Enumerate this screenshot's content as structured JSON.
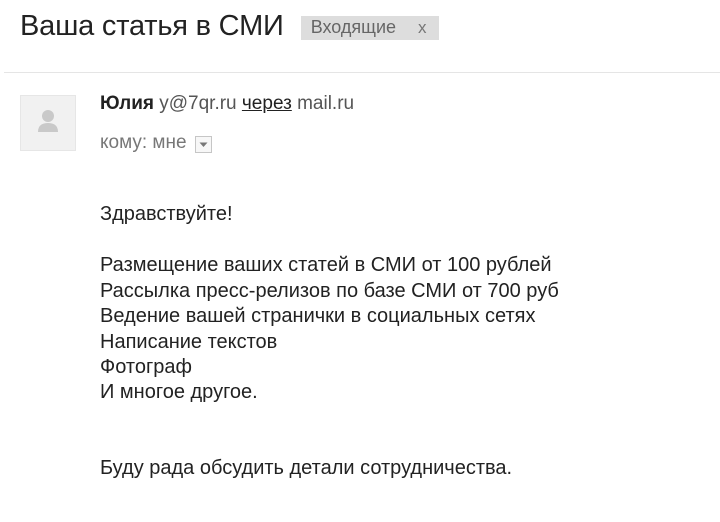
{
  "email": {
    "subject": "Ваша статья в СМИ",
    "label": {
      "name": "Входящие",
      "remove_glyph": "x"
    },
    "sender": {
      "name": "Юлия",
      "email": "y@7qr.ru",
      "via_label": "через",
      "via_domain": "mail.ru",
      "avatar_icon": "person-icon"
    },
    "recipient": {
      "label": "кому: мне",
      "details_icon": "chevron-down-icon"
    },
    "body": {
      "greeting": "Здравствуйте!",
      "offers": [
        "Размещение ваших статей в СМИ от 100 рублей",
        "Рассылка пресс-релизов по базе СМИ от 700 руб",
        "Ведение вашей странички в социальных сетях",
        "Написание текстов",
        "Фотограф",
        "И многое другое."
      ],
      "closing": "Буду рада обсудить детали сотрудничества."
    }
  },
  "colors": {
    "text": "#222222",
    "muted": "#777777",
    "label_chip_bg": "#dddddd",
    "divider": "#e5e5e5",
    "avatar_bg": "#f1f1f1"
  }
}
